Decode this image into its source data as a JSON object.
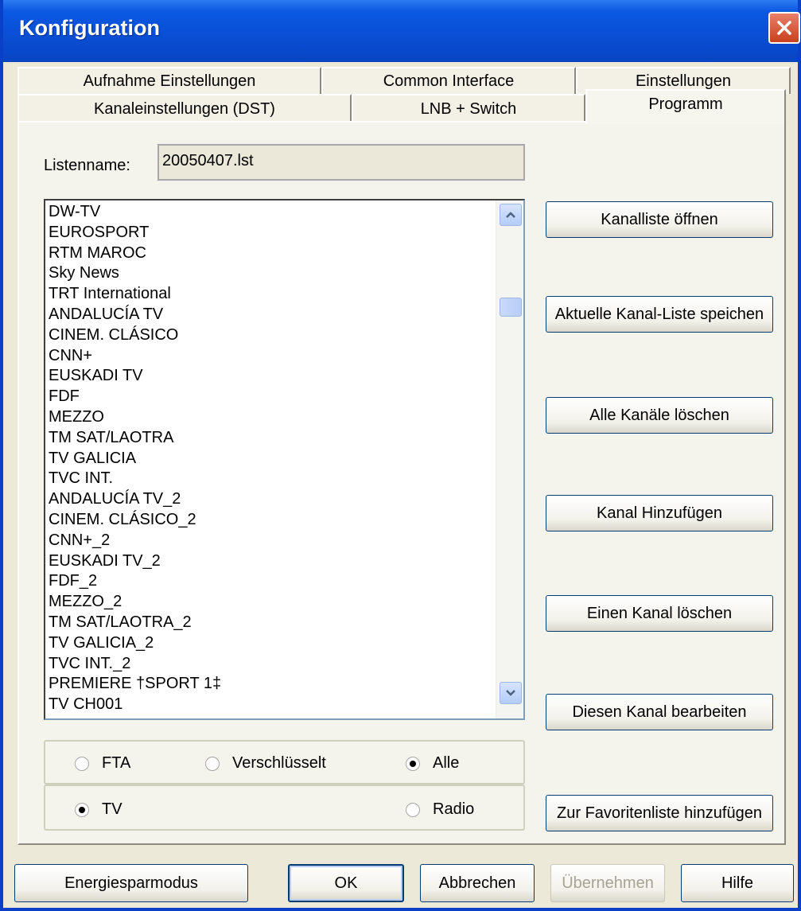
{
  "window": {
    "title": "Konfiguration"
  },
  "tabs_row1": [
    {
      "label": "Aufnahme Einstellungen"
    },
    {
      "label": "Common Interface"
    },
    {
      "label": "Einstellungen"
    }
  ],
  "tabs_row2": [
    {
      "label": "Kanaleinstellungen  (DST)"
    },
    {
      "label": "LNB + Switch"
    },
    {
      "label": "Programm",
      "selected": true
    }
  ],
  "listname": {
    "label": "Listenname:",
    "value": "20050407.lst"
  },
  "channels": [
    "DW-TV",
    "EUROSPORT",
    "RTM MAROC",
    "Sky News",
    "TRT International",
    "ANDALUCÍA TV",
    "CINEM. CLÁSICO",
    "CNN+",
    "EUSKADI TV",
    "FDF",
    "MEZZO",
    "TM SAT/LAOTRA",
    "TV GALICIA",
    "TVC INT.",
    "ANDALUCÍA TV_2",
    "CINEM. CLÁSICO_2",
    "CNN+_2",
    "EUSKADI TV_2",
    "FDF_2",
    "MEZZO_2",
    "TM SAT/LAOTRA_2",
    "TV GALICIA_2",
    "TVC INT._2",
    "PREMIERE †SPORT 1‡",
    "TV CH001"
  ],
  "side_buttons": {
    "open": "Kanalliste öffnen",
    "save": "Aktuelle Kanal-Liste speichen",
    "delete_all": "Alle Kanäle löschen",
    "add": "Kanal Hinzufügen",
    "delete_one": "Einen Kanal löschen",
    "edit": "Diesen Kanal bearbeiten",
    "favorite": "Zur Favoritenliste hinzufügen"
  },
  "filter": {
    "fta": {
      "label": "FTA",
      "checked": false
    },
    "encrypted": {
      "label": "Verschlüsselt",
      "checked": false
    },
    "all": {
      "label": "Alle",
      "checked": true
    },
    "tv": {
      "label": "TV",
      "checked": true
    },
    "radio": {
      "label": "Radio",
      "checked": false
    }
  },
  "footer": {
    "power_save": "Energiesparmodus",
    "ok": "OK",
    "cancel": "Abbrechen",
    "apply": "Übernehmen",
    "help": "Hilfe"
  },
  "colors": {
    "titlebar": "#0A4FD6",
    "dialog_bg": "#ECE9D8",
    "close_button": "#C8401E"
  }
}
